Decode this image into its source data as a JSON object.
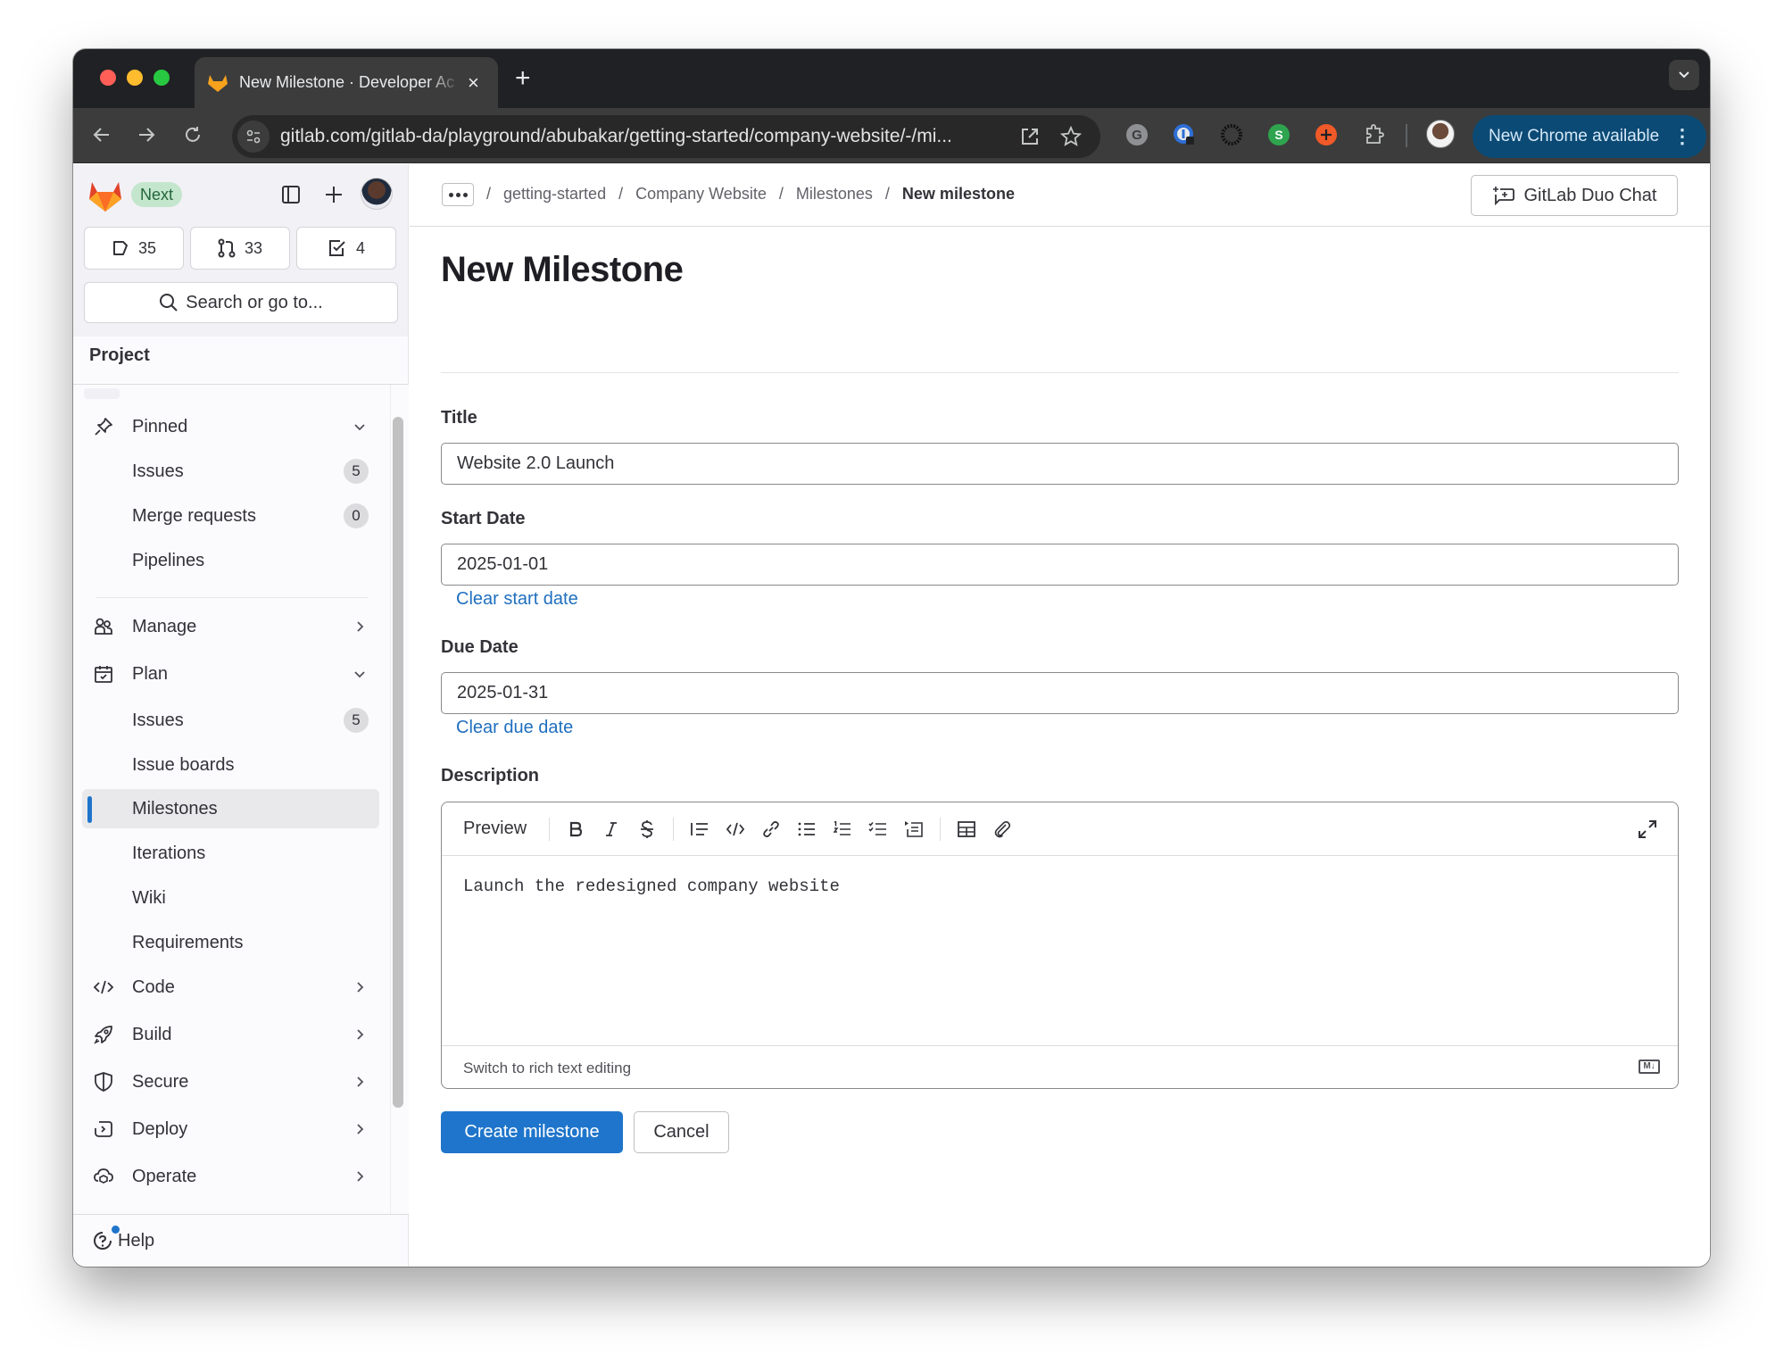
{
  "browser": {
    "tab_title": "New Milestone · Developer Ac",
    "url": "gitlab.com/gitlab-da/playground/abubakar/getting-started/company-website/-/mi...",
    "update_button": "New Chrome available",
    "extensions": [
      "grammarly-icon",
      "password-manager-icon",
      "extension-sun-icon",
      "extension-s-icon",
      "extension-plus-icon",
      "extensions-puzzle-icon"
    ],
    "colors": {
      "update_bg": "#0b4a75"
    }
  },
  "sidebar": {
    "badge": "Next",
    "counts": {
      "issues": "35",
      "merge_requests": "33",
      "todos": "4"
    },
    "search_label": "Search or go to...",
    "section_title": "Project",
    "items": [
      {
        "label": "Pinned",
        "icon": "pin-icon",
        "type": "group",
        "expanded": true
      },
      {
        "label": "Issues",
        "type": "sub",
        "badge": "5"
      },
      {
        "label": "Merge requests",
        "type": "sub",
        "badge": "0"
      },
      {
        "label": "Pipelines",
        "type": "sub"
      },
      {
        "label": "Manage",
        "icon": "users-icon",
        "type": "group",
        "expanded": false
      },
      {
        "label": "Plan",
        "icon": "calendar-icon",
        "type": "group",
        "expanded": true
      },
      {
        "label": "Issues",
        "type": "sub",
        "badge": "5"
      },
      {
        "label": "Issue boards",
        "type": "sub"
      },
      {
        "label": "Milestones",
        "type": "sub",
        "active": true
      },
      {
        "label": "Iterations",
        "type": "sub"
      },
      {
        "label": "Wiki",
        "type": "sub"
      },
      {
        "label": "Requirements",
        "type": "sub"
      },
      {
        "label": "Code",
        "icon": "code-icon",
        "type": "group",
        "expanded": false
      },
      {
        "label": "Build",
        "icon": "rocket-icon",
        "type": "group",
        "expanded": false
      },
      {
        "label": "Secure",
        "icon": "shield-icon",
        "type": "group",
        "expanded": false
      },
      {
        "label": "Deploy",
        "icon": "deploy-icon",
        "type": "group",
        "expanded": false
      },
      {
        "label": "Operate",
        "icon": "operate-icon",
        "type": "group",
        "expanded": false
      }
    ],
    "help_label": "Help",
    "colors": {
      "active_indicator": "#1f75cb",
      "next_badge_bg": "#c3e6cd",
      "next_badge_text": "#24663b"
    }
  },
  "topbar": {
    "breadcrumbs": [
      "getting-started",
      "Company Website",
      "Milestones",
      "New milestone"
    ],
    "duo_chat_label": "GitLab Duo Chat"
  },
  "form": {
    "page_title": "New Milestone",
    "title_label": "Title",
    "title_value": "Website 2.0 Launch",
    "start_date_label": "Start Date",
    "start_date_value": "2025-01-01",
    "clear_start_label": "Clear start date",
    "due_date_label": "Due Date",
    "due_date_value": "2025-01-31",
    "clear_due_label": "Clear due date",
    "description_label": "Description",
    "editor": {
      "preview_label": "Preview",
      "toolbar_icons": [
        "bold-icon",
        "italic-icon",
        "strikethrough-icon",
        "quote-icon",
        "code-icon",
        "link-icon",
        "bullet-list-icon",
        "numbered-list-icon",
        "task-list-icon",
        "collapsible-icon",
        "table-icon",
        "attachment-icon"
      ],
      "content": "Launch the redesigned company website",
      "switch_label": "Switch to rich text editing",
      "markdown_mark": "M↓"
    },
    "submit_label": "Create milestone",
    "cancel_label": "Cancel",
    "colors": {
      "primary": "#1f75cb",
      "link": "#1f6fbf"
    }
  }
}
